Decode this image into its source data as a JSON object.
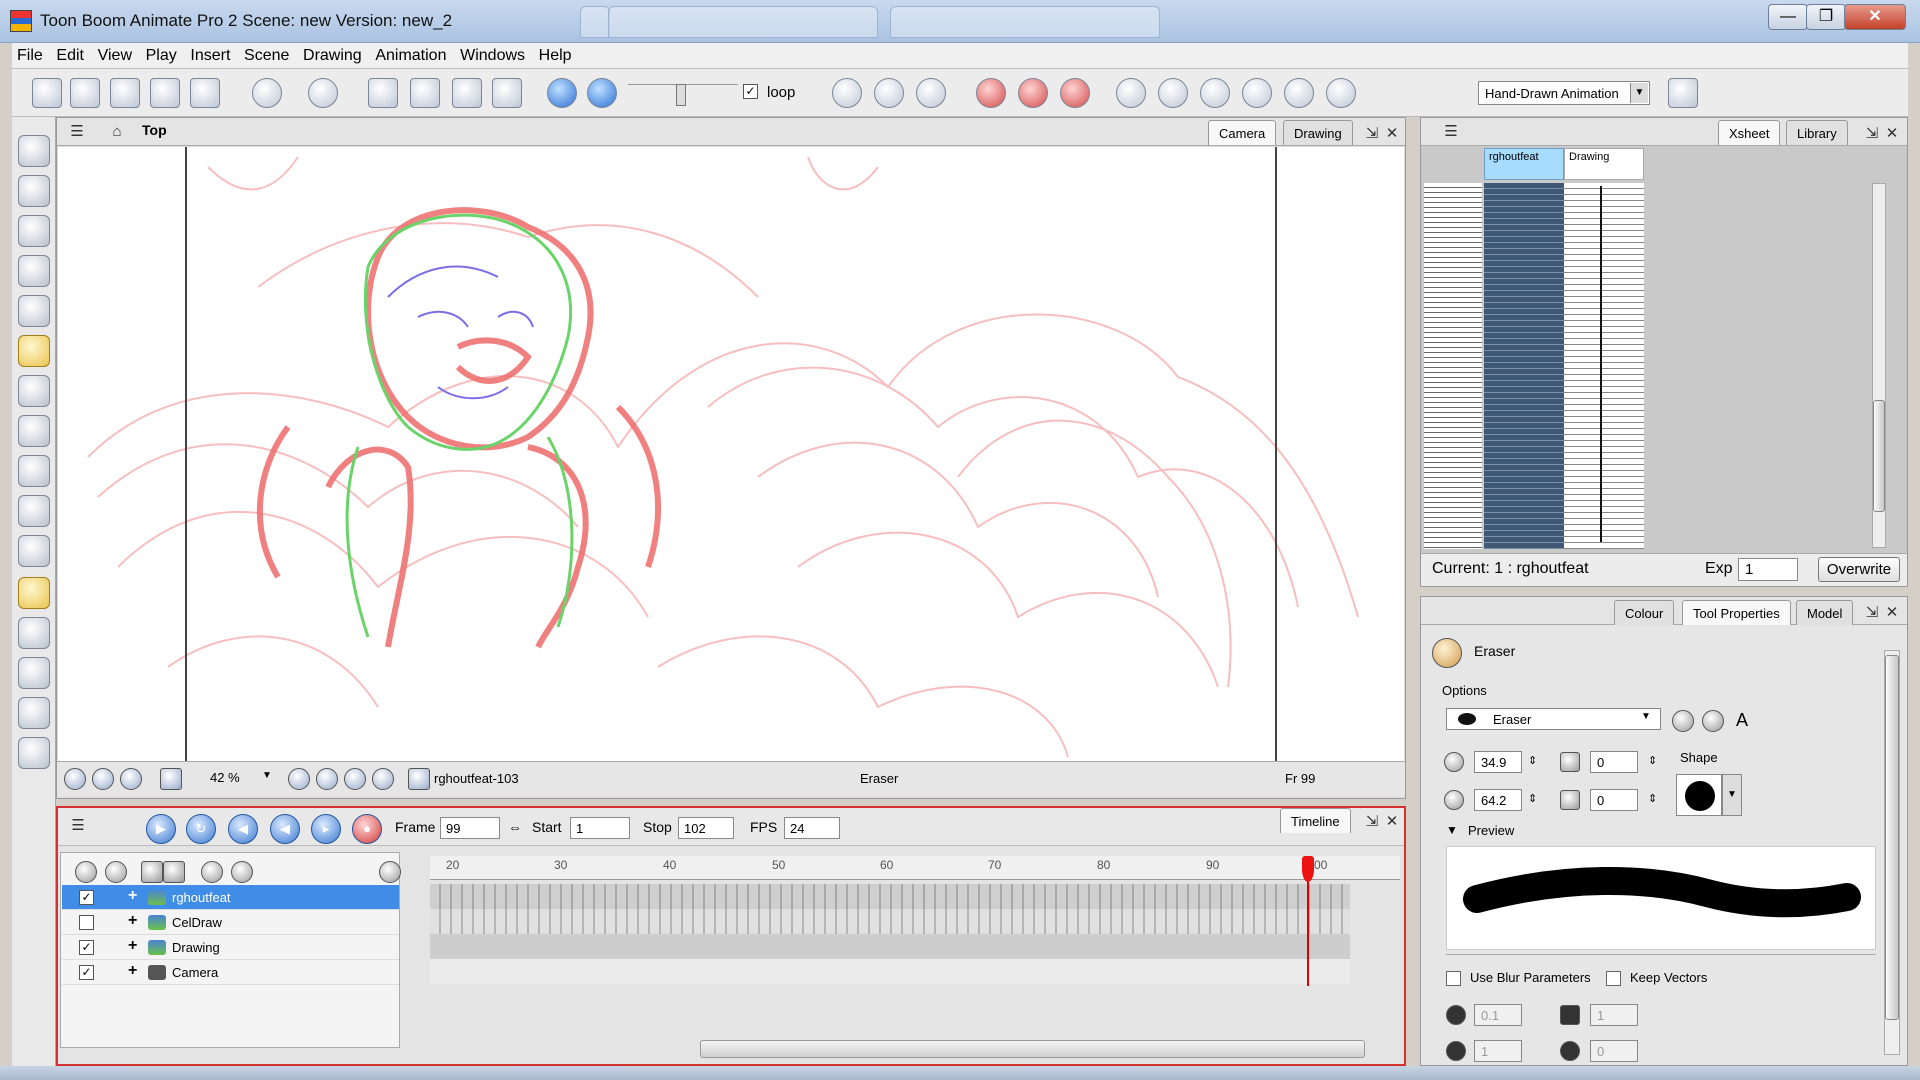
{
  "window": {
    "title": "Toon Boom Animate Pro 2 Scene: new Version: new_2",
    "minimize_glyph": "—",
    "maximize_glyph": "❐",
    "close_glyph": "✕"
  },
  "menubar": [
    "File",
    "Edit",
    "View",
    "Play",
    "Insert",
    "Scene",
    "Drawing",
    "Animation",
    "Windows",
    "Help"
  ],
  "toolbar": {
    "loop_label": "loop",
    "loop_checked": true,
    "workspace_mode": "Hand-Drawn Animation"
  },
  "camera_view": {
    "breadcrumb": "Top",
    "tabs": [
      "Camera",
      "Drawing"
    ],
    "active_tab": "Camera",
    "zoom": "42 %",
    "drawing_name": "rghoutfeat-103",
    "current_tool": "Eraser",
    "frame_indicator": "Fr 99"
  },
  "timeline": {
    "tab_label": "Timeline",
    "frame_label": "Frame",
    "frame_value": "99",
    "start_label": "Start",
    "start_value": "1",
    "stop_label": "Stop",
    "stop_value": "102",
    "fps_label": "FPS",
    "fps_value": "24",
    "ruler_ticks": [
      "20",
      "30",
      "40",
      "50",
      "60",
      "70",
      "80",
      "90",
      "00"
    ],
    "current_frame": 99,
    "layers": [
      {
        "name": "rghoutfeat",
        "visible": true,
        "selected": true
      },
      {
        "name": "CelDraw",
        "visible": false,
        "selected": false
      },
      {
        "name": "Drawing",
        "visible": true,
        "selected": false
      },
      {
        "name": "Camera",
        "visible": true,
        "selected": false
      }
    ]
  },
  "xsheet": {
    "tabs": [
      "Xsheet",
      "Library"
    ],
    "active_tab": "Xsheet",
    "columns": [
      "rghoutfeat",
      "Drawing"
    ],
    "current_label": "Current: 1 : rghoutfeat",
    "exp_label": "Exp",
    "exp_value": "1",
    "overwrite_label": "Overwrite"
  },
  "tool_properties": {
    "tabs": [
      "Colour",
      "Tool Properties",
      "Model"
    ],
    "active_tab": "Tool Properties",
    "tool_name": "Eraser",
    "options_label": "Options",
    "eraser_preset": "Eraser",
    "size_max": "34.9",
    "size_min": "64.2",
    "smoothing": "0",
    "contour_smoothing": "0",
    "shape_label": "Shape",
    "preview_label": "Preview",
    "use_blur_label": "Use Blur Parameters",
    "keep_vectors_label": "Keep Vectors",
    "blur_value": "0.1",
    "blur_steps": "1",
    "blur_a": "1",
    "blur_b": "0"
  }
}
